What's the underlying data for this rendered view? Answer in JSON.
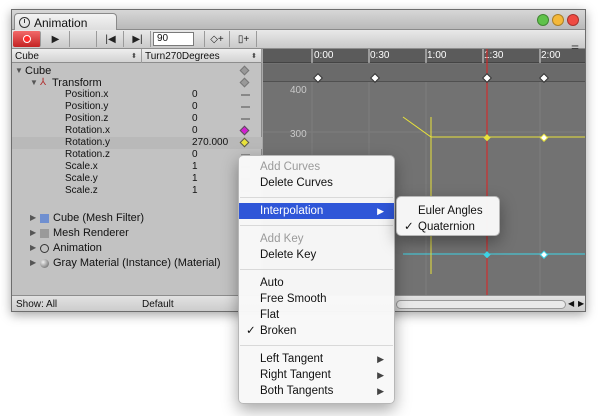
{
  "window": {
    "tab_title": "Animation"
  },
  "toolbar": {
    "frame_value": "90"
  },
  "selectors": {
    "object": "Cube",
    "clip": "Turn270Degrees"
  },
  "tree": {
    "root": "Cube",
    "transform": "Transform",
    "properties": [
      {
        "name": "Position.x",
        "value": "0"
      },
      {
        "name": "Position.y",
        "value": "0"
      },
      {
        "name": "Position.z",
        "value": "0"
      },
      {
        "name": "Rotation.x",
        "value": "0"
      },
      {
        "name": "Rotation.y",
        "value": "270.000"
      },
      {
        "name": "Rotation.z",
        "value": "0"
      },
      {
        "name": "Scale.x",
        "value": "1"
      },
      {
        "name": "Scale.y",
        "value": "1"
      },
      {
        "name": "Scale.z",
        "value": "1"
      }
    ],
    "components": [
      "Cube (Mesh Filter)",
      "Mesh Renderer",
      "Animation",
      "Gray Material (Instance) (Material)"
    ]
  },
  "status": {
    "show": "Show: All",
    "mode": "Default"
  },
  "timeline": {
    "ticks": [
      "0:00",
      "0:30",
      "1:00",
      "1:30",
      "2:00"
    ]
  },
  "graph": {
    "y_labels": [
      "400",
      "300"
    ],
    "colors": {
      "yellow": "#e8e23a",
      "cyan": "#3fd6e8",
      "playhead": "#e22020"
    }
  },
  "context_menu": {
    "add_curves": "Add Curves",
    "delete_curves": "Delete Curves",
    "interpolation": "Interpolation",
    "add_key": "Add Key",
    "delete_key": "Delete Key",
    "auto": "Auto",
    "free_smooth": "Free Smooth",
    "flat": "Flat",
    "broken": "Broken",
    "left_tangent": "Left Tangent",
    "right_tangent": "Right Tangent",
    "both_tangents": "Both Tangents",
    "check": "✓",
    "submenu_arrow": "▶"
  },
  "submenu": {
    "euler": "Euler Angles",
    "quaternion": "Quaternion"
  }
}
